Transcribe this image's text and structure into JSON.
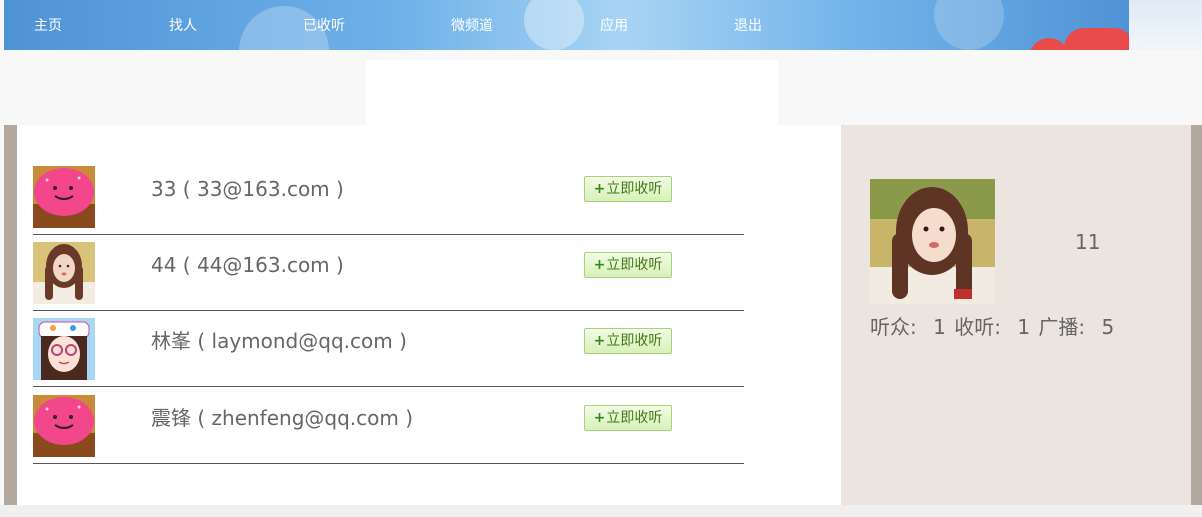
{
  "nav": {
    "items": [
      {
        "label": "主页"
      },
      {
        "label": "找人"
      },
      {
        "label": "已收听"
      },
      {
        "label": "微频道"
      },
      {
        "label": "应用"
      },
      {
        "label": "退出"
      }
    ]
  },
  "users": [
    {
      "name": "33 ( 33@163.com )",
      "follow_label": "立即收听",
      "avatar": "pink-cupcake-avatar"
    },
    {
      "name": "44 ( 44@163.com )",
      "follow_label": "立即收听",
      "avatar": "girl-photo-avatar"
    },
    {
      "name": "林峯 ( laymond@qq.com )",
      "follow_label": "立即收听",
      "avatar": "cartoon-girl-avatar"
    },
    {
      "name": "震锋 ( zhenfeng@qq.com )",
      "follow_label": "立即收听",
      "avatar": "pink-cupcake-avatar"
    }
  ],
  "profile": {
    "id": "11",
    "listeners_label": "听众:",
    "listeners_value": "1",
    "following_label": "收听:",
    "following_value": "1",
    "broadcasts_label": "广播:",
    "broadcasts_value": "5"
  },
  "colors": {
    "nav_blue": "#4f93d6",
    "follow_green": "#3f7a14",
    "sidebar_bg": "#ece4de",
    "frame": "#b3a89e"
  }
}
